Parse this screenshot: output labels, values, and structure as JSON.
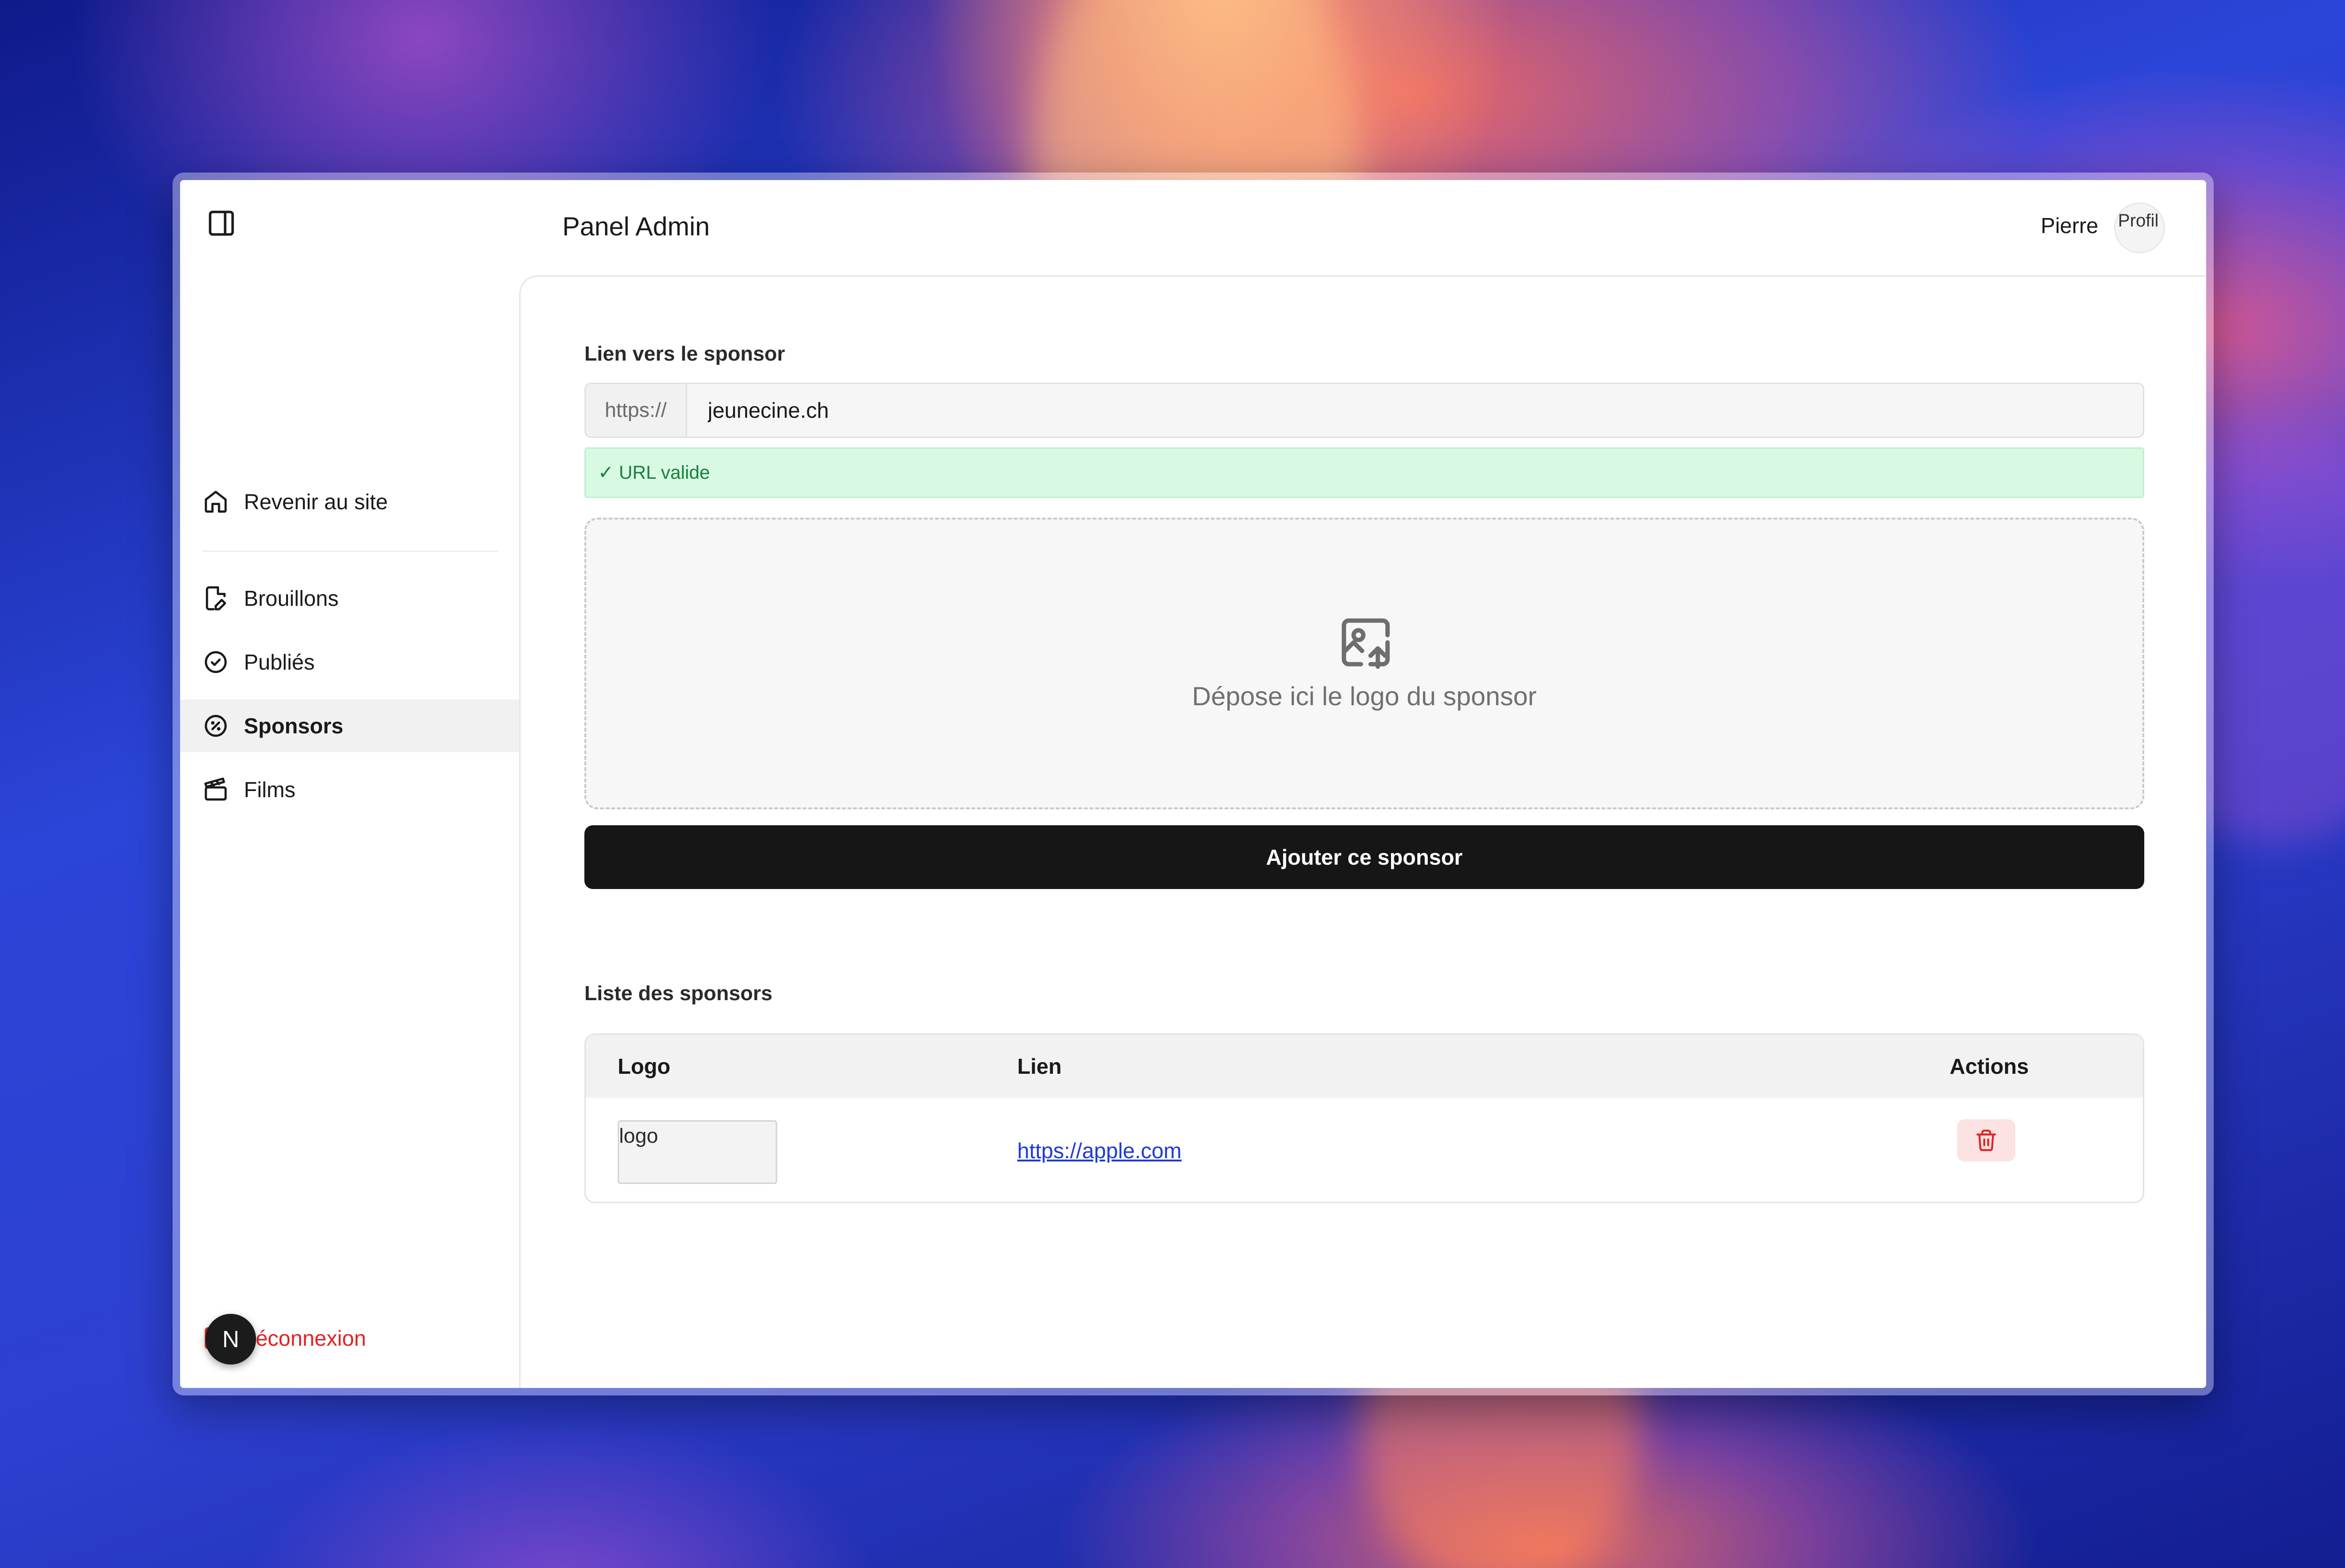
{
  "app": {
    "title": "Panel Admin",
    "user_name": "Pierre",
    "avatar_alt": "Profil"
  },
  "sidebar": {
    "items": [
      {
        "label": "Revenir au site",
        "icon": "home-icon"
      },
      {
        "label": "Brouillons",
        "icon": "file-edit-icon"
      },
      {
        "label": "Publiés",
        "icon": "check-circle-icon"
      },
      {
        "label": "Sponsors",
        "icon": "badge-percent-icon",
        "active": true
      },
      {
        "label": "Films",
        "icon": "clapperboard-icon"
      }
    ],
    "logout_label": "Déconnexion",
    "next_badge": "N"
  },
  "form": {
    "link_label": "Lien vers le sponsor",
    "url_prefix": "https://",
    "url_value": "jeunecine.ch",
    "valid_message": "✓ URL valide",
    "dropzone_text": "Dépose ici le logo du sponsor",
    "submit_label": "Ajouter ce sponsor"
  },
  "sponsors": {
    "title": "Liste des sponsors",
    "columns": [
      "Logo",
      "Lien",
      "Actions"
    ],
    "rows": [
      {
        "logo_alt": "logo",
        "link": "https://apple.com"
      }
    ]
  },
  "colors": {
    "accent": "#161616",
    "valid_bg": "#d8f9e2",
    "valid_text": "#17803d",
    "danger": "#e02424",
    "link": "#1f3bd6"
  }
}
